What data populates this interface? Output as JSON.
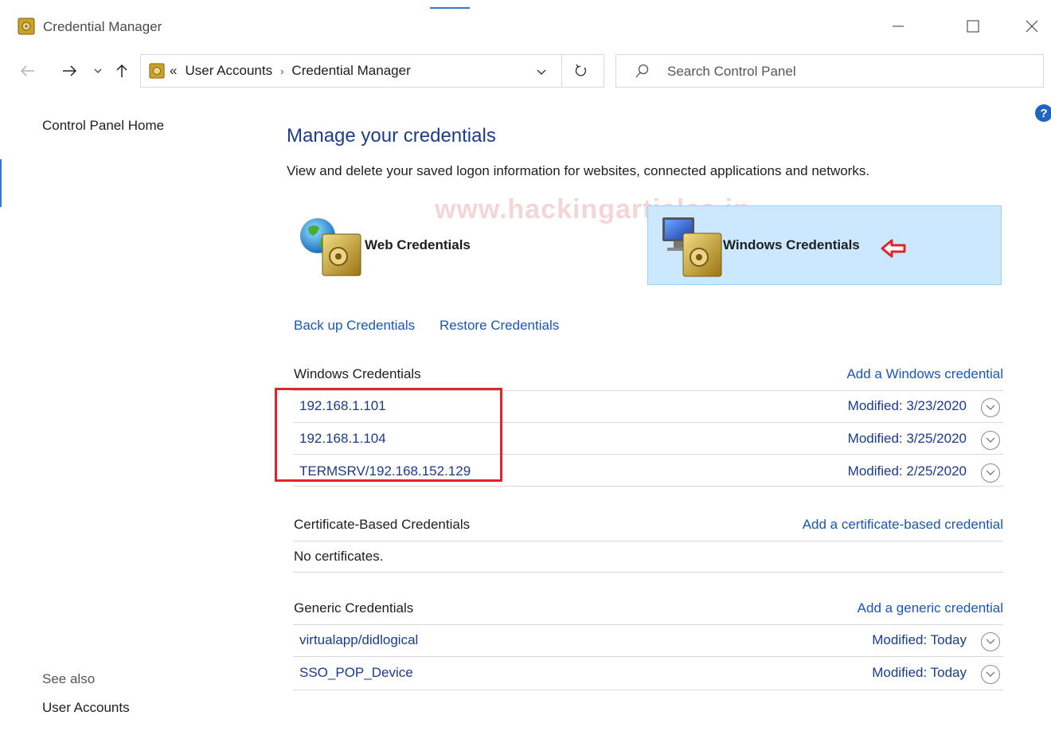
{
  "window": {
    "title": "Credential Manager",
    "controls": [
      "minimize",
      "maximize",
      "close"
    ]
  },
  "nav": {
    "breadcrumb": [
      "User Accounts",
      "Credential Manager"
    ],
    "breadcrumb_prefix": "«",
    "search_placeholder": "Search Control Panel"
  },
  "left_pane": {
    "home_link": "Control Panel Home",
    "see_also_label": "See also",
    "see_also_links": [
      "User Accounts"
    ]
  },
  "main": {
    "heading": "Manage your credentials",
    "description": "View and delete your saved logon information for websites, connected applications and networks.",
    "watermark": "www.hackingarticles.in",
    "tiles": {
      "web": "Web Credentials",
      "windows": "Windows Credentials"
    },
    "backup_link": "Back up Credentials",
    "restore_link": "Restore Credentials",
    "sections": {
      "windows": {
        "title": "Windows Credentials",
        "add_link": "Add a Windows credential",
        "items": [
          {
            "name": "192.168.1.101",
            "modified": "Modified:  3/23/2020"
          },
          {
            "name": "192.168.1.104",
            "modified": "Modified:  3/25/2020"
          },
          {
            "name": "TERMSRV/192.168.152.129",
            "modified": "Modified:  2/25/2020"
          }
        ]
      },
      "certificate": {
        "title": "Certificate-Based Credentials",
        "add_link": "Add a certificate-based credential",
        "empty_text": "No certificates."
      },
      "generic": {
        "title": "Generic Credentials",
        "add_link": "Add a generic credential",
        "items": [
          {
            "name": "virtualapp/didlogical",
            "modified": "Modified:  Today"
          },
          {
            "name": "SSO_POP_Device",
            "modified": "Modified:  Today"
          }
        ]
      }
    }
  },
  "colors": {
    "link": "#1a56b3",
    "heading": "#1c3d8c",
    "selected_tile_bg": "#cce8ff",
    "annotation_red": "#e0242b"
  },
  "icons": [
    "credential-manager-icon",
    "back-arrow-icon",
    "forward-arrow-icon",
    "recent-dropdown-icon",
    "up-arrow-icon",
    "refresh-icon",
    "search-icon",
    "help-icon",
    "globe-vault-icon",
    "computer-vault-icon",
    "expand-chevron-icon"
  ]
}
